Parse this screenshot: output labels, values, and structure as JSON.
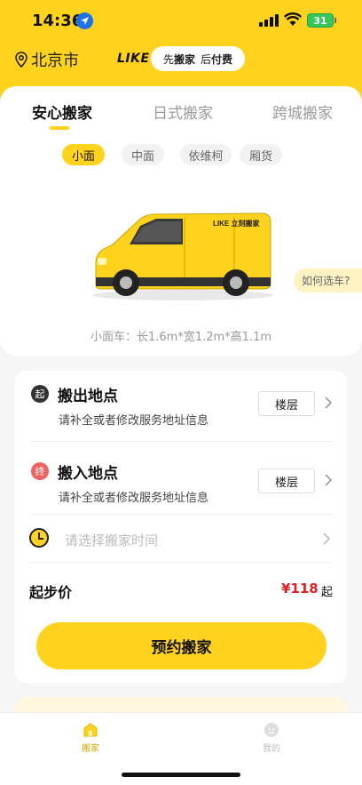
{
  "status_bar": {
    "time": "14:36",
    "battery": "31"
  },
  "header": {
    "city": "北京市",
    "brand": "LIKE",
    "slogan": {
      "part1": "先",
      "part2": "搬家",
      "part3": "后",
      "part4": "付费"
    }
  },
  "service_tabs": [
    {
      "label": "安心搬家",
      "active": true
    },
    {
      "label": "日式搬家",
      "active": false
    },
    {
      "label": "跨城搬家",
      "active": false
    }
  ],
  "vehicle_types": [
    {
      "label": "小面",
      "active": true
    },
    {
      "label": "中面",
      "active": false
    },
    {
      "label": "依维柯",
      "active": false
    },
    {
      "label": "厢货",
      "active": false
    }
  ],
  "van_brand_text": "LIKE 立刻搬家",
  "choose_vehicle_label": "如何选车?",
  "vehicle_spec": "小面车：长1.6m*宽1.2m*高1.1m",
  "form": {
    "from": {
      "badge": "起",
      "title": "搬出地点",
      "subtitle": "请补全或者修改服务地址信息",
      "floor_label": "楼层"
    },
    "to": {
      "badge": "终",
      "title": "搬入地点",
      "subtitle": "请补全或者修改服务地址信息",
      "floor_label": "楼层"
    },
    "time_placeholder": "请选择搬家时间",
    "price_label": "起步价",
    "price": "¥118",
    "price_suffix": "起",
    "book_button": "预约搬家"
  },
  "tabbar": [
    {
      "label": "搬家",
      "active": true
    },
    {
      "label": "我的",
      "active": false
    }
  ],
  "colors": {
    "accent": "#ffd21e",
    "price": "#e02020",
    "from_badge": "#333333",
    "to_badge": "#f06262"
  }
}
